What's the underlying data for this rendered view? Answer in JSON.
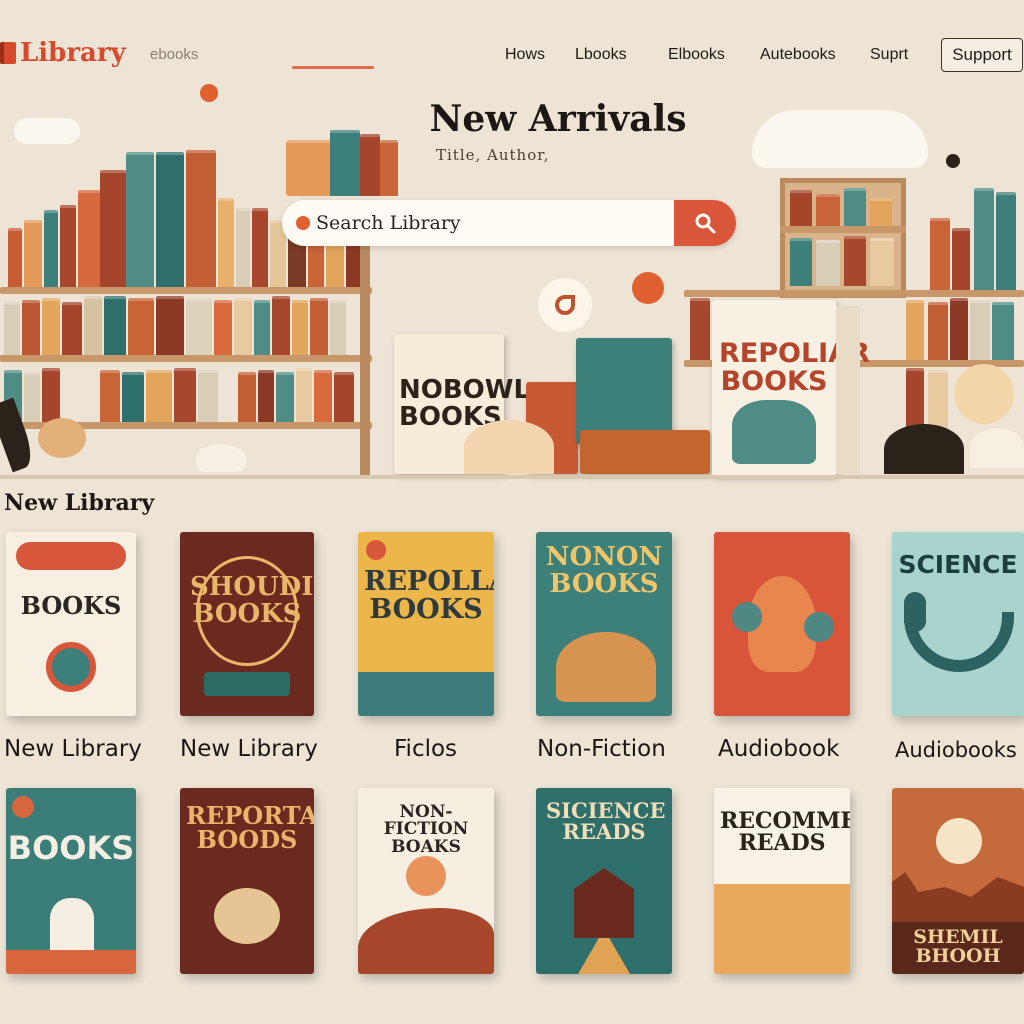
{
  "nav": {
    "logo_text": "Library",
    "muted_link": "ebooks",
    "muted_link_2": "",
    "links": [
      "Hows",
      "Lbooks",
      "Elbooks",
      "Autebooks",
      "Suprt"
    ],
    "support_button": "Support"
  },
  "hero": {
    "title": "New Arrivals",
    "subtitle": "Title, Author,",
    "search_placeholder": "Search Library",
    "featured_books": [
      {
        "title": "NOBOWL BOOKS"
      },
      {
        "title": "REPOLIAR BOOKS"
      }
    ]
  },
  "section": {
    "title": "New Library"
  },
  "row1_books": [
    {
      "title": "BOOKS",
      "colors": {
        "bg": "#f6efe2",
        "fg": "#2a2520",
        "accent": "#d8573a"
      }
    },
    {
      "title": "SHOUDIR BOOKS",
      "colors": {
        "bg": "#6b2a1f",
        "fg": "#e9b769",
        "accent": "#2c6b62"
      }
    },
    {
      "title": "REPOLLAR BOOKS",
      "colors": {
        "bg": "#ecb64a",
        "fg": "#2e3a3c",
        "accent": "#3c7b7b"
      }
    },
    {
      "title": "NONON BOOKS",
      "colors": {
        "bg": "#3d8079",
        "fg": "#f0c66a",
        "accent": "#d69450"
      }
    },
    {
      "title": "",
      "colors": {
        "bg": "#d9553a",
        "fg": "#f6e2c2",
        "accent": "#4f8782"
      }
    },
    {
      "title": "SCIENCE",
      "colors": {
        "bg": "#a9d4cd",
        "fg": "#1d3e3f",
        "accent": "#2d6260"
      }
    }
  ],
  "categories": [
    "New Library",
    "New Library",
    "Ficlos",
    "Non-Fiction",
    "Audiobook",
    "Audiobooks"
  ],
  "row2_books": [
    {
      "title": "BOOKS",
      "colors": {
        "bg": "#3b7d79",
        "fg": "#f4efe2",
        "accent": "#d8673d"
      }
    },
    {
      "title": "REPORTAR BOODS",
      "colors": {
        "bg": "#6b2a1f",
        "fg": "#e8b56b",
        "accent": "#e7c494"
      }
    },
    {
      "title": "NON-FICTION BOAKS",
      "colors": {
        "bg": "#f6eee0",
        "fg": "#2a2520",
        "accent": "#a6472c"
      }
    },
    {
      "title": "SICIENCE READS",
      "colors": {
        "bg": "#2f6f6b",
        "fg": "#f2dfb8",
        "accent": "#e0a253"
      }
    },
    {
      "title": "RECOMMENDED READS",
      "colors": {
        "bg": "#f1dfbd",
        "fg": "#2b2219",
        "accent": "#e9a85c"
      }
    },
    {
      "title": "SHEMIL BHOOH",
      "colors": {
        "bg": "#c46a3b",
        "fg": "#f0d29a",
        "accent": "#5a281b"
      }
    }
  ]
}
